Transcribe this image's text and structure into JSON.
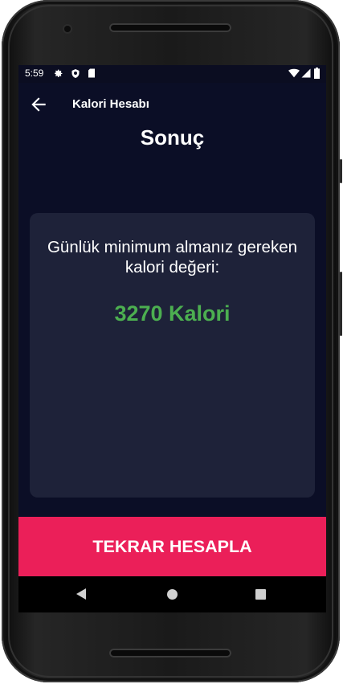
{
  "status_bar": {
    "time": "5:59"
  },
  "app_bar": {
    "title": "Kalori Hesabı"
  },
  "page": {
    "title": "Sonuç"
  },
  "result": {
    "label": "Günlük minimum almanız gereken kalori değeri:",
    "value": "3270 Kalori"
  },
  "actions": {
    "recalculate_label": "TEKRAR HESAPLA"
  },
  "colors": {
    "background": "#0b0e26",
    "card": "#1e2239",
    "accent": "#eb1f59",
    "value_green": "#4caf50"
  },
  "icons": {
    "status_left": [
      "settings-icon",
      "shield-icon",
      "sd-card-icon"
    ],
    "status_right": [
      "wifi-icon",
      "signal-icon",
      "battery-icon"
    ],
    "app_bar": "arrow-back-icon",
    "navigation": [
      "nav-back-icon",
      "nav-home-icon",
      "nav-recents-icon"
    ]
  }
}
